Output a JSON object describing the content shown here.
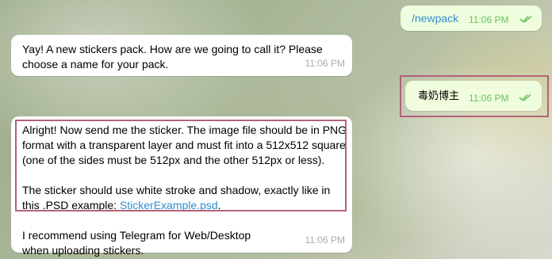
{
  "messages": [
    {
      "side": "out",
      "text": "/newpack",
      "time": "11:06 PM",
      "status": "read"
    },
    {
      "side": "in",
      "text": "Yay! A new stickers pack. How are we going to call it? Please choose a name for your pack.",
      "time": "11:06 PM"
    },
    {
      "side": "out",
      "text": "毒奶博主",
      "time": "11:06 PM",
      "status": "read"
    },
    {
      "side": "in",
      "paragraph1": "Alright! Now send me the sticker. The image file should be in PNG format with a transparent layer and must fit into a 512x512 square (one of the sides must be 512px and the other 512px or less).",
      "paragraph2_prefix": "The sticker should use white stroke and shadow, exactly like in this .PSD example: ",
      "link": "StickerExample.psd",
      "paragraph2_suffix": ".",
      "paragraph3": "I recommend using Telegram for Web/Desktop when uploading stickers.",
      "time": "11:06 PM"
    }
  ],
  "colors": {
    "incoming_bubble": "#ffffff",
    "outgoing_bubble": "#effdde",
    "link": "#2f8fd1",
    "highlight_border": "#b0637a"
  },
  "icons": {
    "read_status": "double-check-icon"
  }
}
